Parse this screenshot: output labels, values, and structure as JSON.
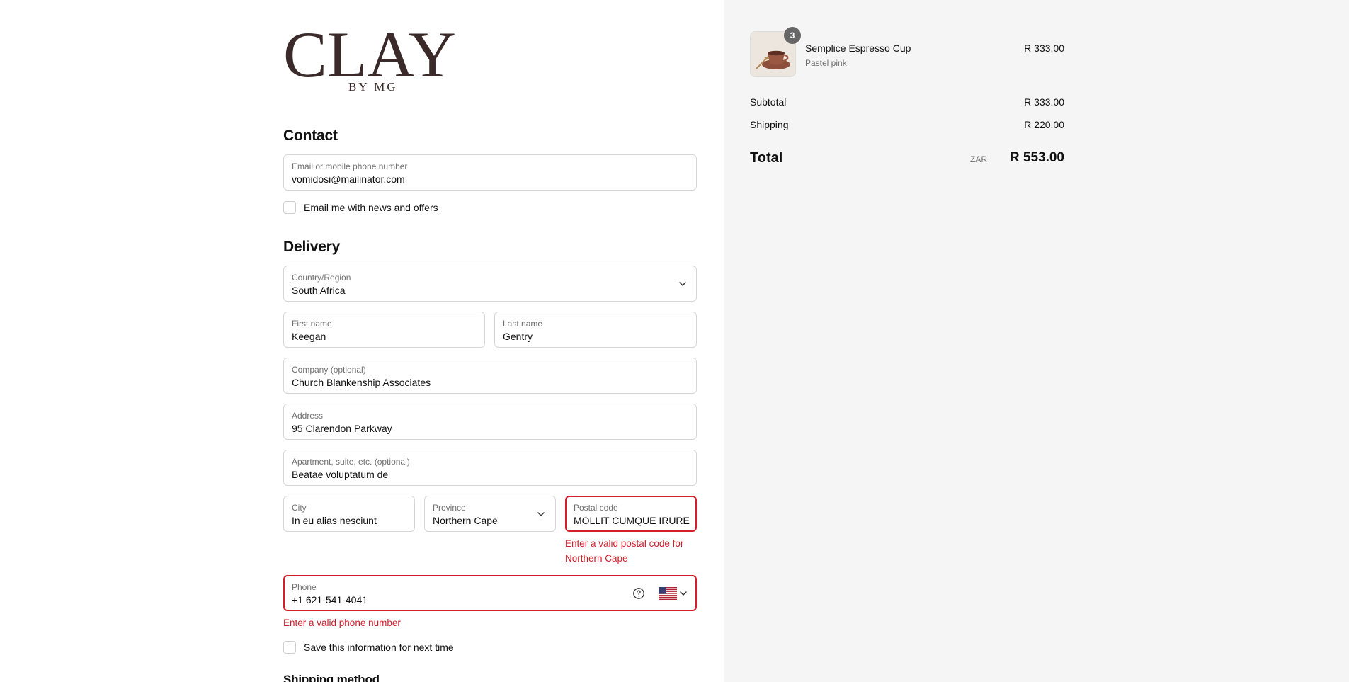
{
  "logo": {
    "brand": "CLAY",
    "tagline": "BY MG",
    "color": "#3b2a2a"
  },
  "contact": {
    "title": "Contact",
    "email_label": "Email or mobile phone number",
    "email_value": "vomidosi@mailinator.com",
    "news_label": "Email me with news and offers"
  },
  "delivery": {
    "title": "Delivery",
    "country_label": "Country/Region",
    "country_value": "South Africa",
    "first_name_label": "First name",
    "first_name_value": "Keegan",
    "last_name_label": "Last name",
    "last_name_value": "Gentry",
    "company_label": "Company (optional)",
    "company_value": "Church Blankenship Associates",
    "address_label": "Address",
    "address_value": "95 Clarendon Parkway",
    "apartment_label": "Apartment, suite, etc. (optional)",
    "apartment_value": "Beatae voluptatum de",
    "city_label": "City",
    "city_value": "In eu alias nesciunt",
    "province_label": "Province",
    "province_value": "Northern Cape",
    "postal_label": "Postal code",
    "postal_value": "MOLLIT CUMQUE IRURE",
    "postal_error_line1": "Enter a valid postal code for",
    "postal_error_line2": "Northern Cape",
    "phone_label": "Phone",
    "phone_value": "+1 621-541-4041",
    "phone_error": "Enter a valid phone number",
    "save_info_label": "Save this information for next time"
  },
  "shipping": {
    "title": "Shipping method"
  },
  "summary": {
    "item": {
      "name": "Semplice Espresso Cup",
      "variant": "Pastel pink",
      "quantity": "3",
      "price": "R 333.00"
    },
    "subtotal_label": "Subtotal",
    "subtotal_value": "R 333.00",
    "shipping_label": "Shipping",
    "shipping_value": "R 220.00",
    "total_label": "Total",
    "total_currency": "ZAR",
    "total_value": "R 553.00"
  },
  "colors": {
    "error": "#d21f2b",
    "summary_bg": "#f5f5f5",
    "badge": "#666666"
  }
}
